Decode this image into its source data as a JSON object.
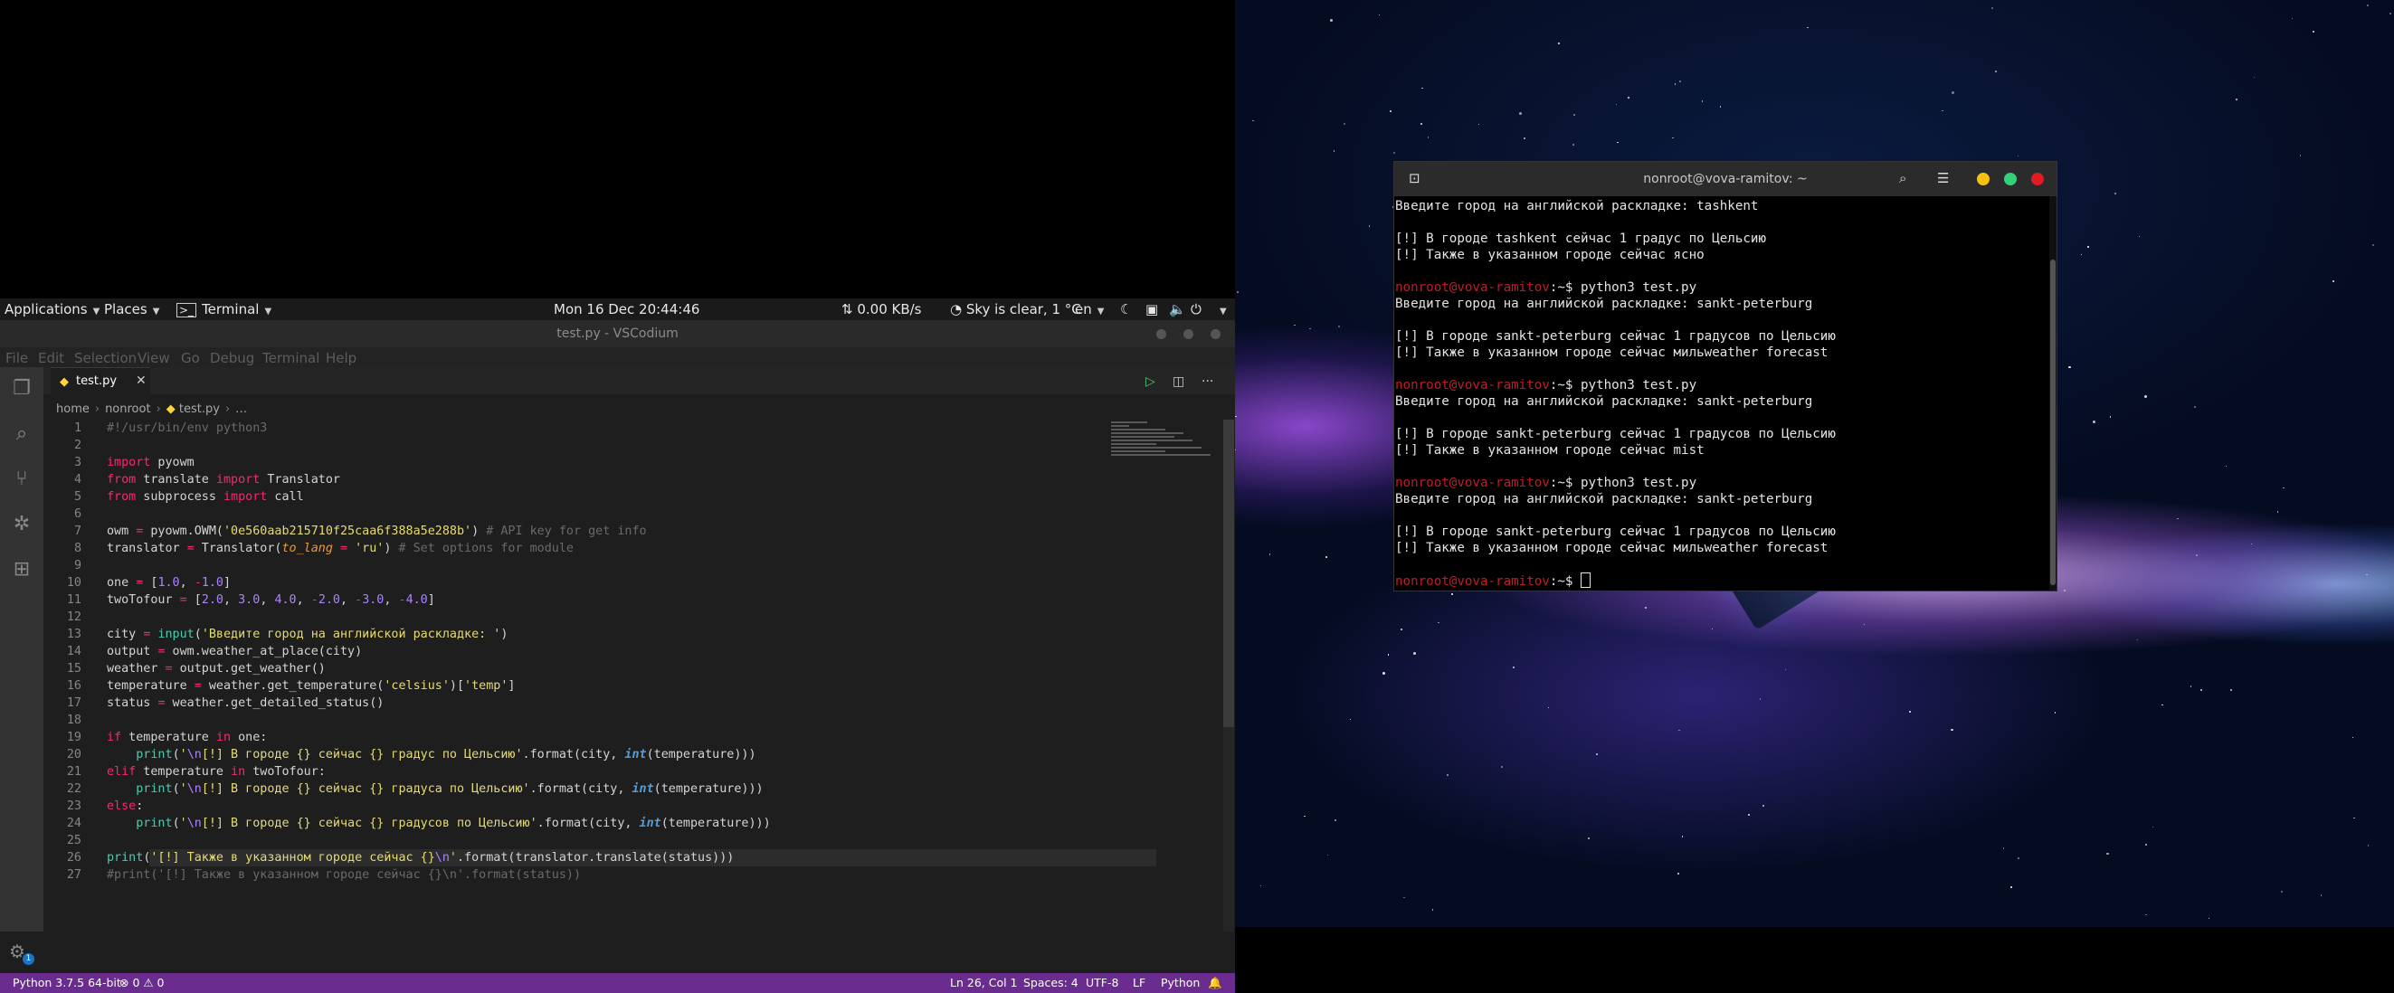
{
  "topbar": {
    "applications": "Applications",
    "places": "Places",
    "terminal": "Terminal",
    "clock": "Mon 16 Dec  20:44:46",
    "netspeed": "⇅ 0.00 KB/s",
    "weather": "Sky is clear, 1 °C",
    "lang": "en"
  },
  "vscode": {
    "title": "test.py - VSCodium",
    "menu": [
      "File",
      "Edit",
      "Selection",
      "View",
      "Go",
      "Debug",
      "Terminal",
      "Help"
    ],
    "tab_label": "test.py",
    "breadcrumb": [
      "home",
      "nonroot",
      "test.py",
      "…"
    ],
    "code_lines": [
      {
        "n": "1",
        "html": "<span class=\"dim\">#!/usr/bin/env python3</span>"
      },
      {
        "n": "2",
        "html": ""
      },
      {
        "n": "3",
        "html": "<span class=\"op\">import</span> pyowm"
      },
      {
        "n": "4",
        "html": "<span class=\"op\">from</span> translate <span class=\"op\">import</span> Translator"
      },
      {
        "n": "5",
        "html": "<span class=\"op\">from</span> subprocess <span class=\"op\">import</span> call"
      },
      {
        "n": "6",
        "html": ""
      },
      {
        "n": "7",
        "html": "owm <span class=\"op\">=</span> pyowm.OWM(<span class=\"ystr\">'0e560aab215710f25caa6f388a5e288b'</span>) <span class=\"dim\"># API key for get info</span>"
      },
      {
        "n": "8",
        "html": "translator <span class=\"op\">=</span> Translator(<span class=\"par\" style=\"color:#fd971f\">to_lang</span> <span class=\"op\">=</span> <span class=\"ystr\">'ru'</span>) <span class=\"dim\"># Set options for module</span>"
      },
      {
        "n": "9",
        "html": ""
      },
      {
        "n": "10",
        "html": "one <span class=\"op\">=</span> [<span class=\"pur\">1.0</span>, <span class=\"op\">-</span><span class=\"pur\">1.0</span>]"
      },
      {
        "n": "11",
        "html": "twoTofour <span class=\"op\">=</span> [<span class=\"pur\">2.0</span>, <span class=\"pur\">3.0</span>, <span class=\"pur\">4.0</span>, <span class=\"op\">-</span><span class=\"pur\">2.0</span>, <span class=\"op\">-</span><span class=\"pur\">3.0</span>, <span class=\"op\">-</span><span class=\"pur\">4.0</span>]"
      },
      {
        "n": "12",
        "html": ""
      },
      {
        "n": "13",
        "html": "city <span class=\"op\">=</span> <span class=\"cyan\">input</span>(<span class=\"ystr\">'Введите город на английской раскладке: '</span>)"
      },
      {
        "n": "14",
        "html": "output <span class=\"op\">=</span> owm.weather_at_place(city)"
      },
      {
        "n": "15",
        "html": "weather <span class=\"op\">=</span> output.get_weather()"
      },
      {
        "n": "16",
        "html": "temperature <span class=\"op\">=</span> weather.get_temperature(<span class=\"ystr\">'celsius'</span>)[<span class=\"ystr\">'temp'</span>]"
      },
      {
        "n": "17",
        "html": "status <span class=\"op\">=</span> weather.get_detailed_status()"
      },
      {
        "n": "18",
        "html": ""
      },
      {
        "n": "19",
        "html": "<span class=\"op\">if</span> temperature <span class=\"op\">in</span> one:"
      },
      {
        "n": "20",
        "html": "    <span class=\"cyan\">print</span>(<span class=\"ystr\">'</span><span class=\"pur\">\\n</span><span class=\"ystr\">[!] В городе {} сейчас {} градус по Цельсию'</span>.format(city, <span class=\"ib\">int</span>(temperature)))"
      },
      {
        "n": "21",
        "html": "<span class=\"op\">elif</span> temperature <span class=\"op\">in</span> twoTofour:"
      },
      {
        "n": "22",
        "html": "    <span class=\"cyan\">print</span>(<span class=\"ystr\">'</span><span class=\"pur\">\\n</span><span class=\"ystr\">[!] В городе {} сейчас {} градуса по Цельсию'</span>.format(city, <span class=\"ib\">int</span>(temperature)))"
      },
      {
        "n": "23",
        "html": "<span class=\"op\">else</span>:"
      },
      {
        "n": "24",
        "html": "    <span class=\"cyan\">print</span>(<span class=\"ystr\">'</span><span class=\"pur\">\\n</span><span class=\"ystr\">[!] В городе {} сейчас {} градусов по Цельсию'</span>.format(city, <span class=\"ib\">int</span>(temperature)))"
      },
      {
        "n": "25",
        "html": ""
      },
      {
        "n": "26",
        "html": "<span class=\"cyan\">print</span>(<span class=\"ystr\">'[!] Также в указанном городе сейчас {}</span><span class=\"pur\">\\n</span><span class=\"ystr\">'</span>.format(translator.translate(status)))"
      },
      {
        "n": "27",
        "html": "<span class=\"dim\">#print('[!] Также в указанном городе сейчас {}\\n'.format(status))</span>"
      }
    ],
    "status": {
      "python": "Python 3.7.5 64-bit",
      "problems": "⊗ 0 ⚠ 0",
      "position": "Ln 26, Col 1",
      "spaces": "Spaces: 4",
      "encoding": "UTF-8",
      "eol": "LF",
      "language": "Python"
    },
    "gear_badge": "1"
  },
  "terminal": {
    "title": "nonroot@vova-ramitov: ~",
    "lines": [
      {
        "t": "Введите город на английской раскладке: tashkent"
      },
      {
        "t": ""
      },
      {
        "t": "[!] В городе tashkent сейчас 1 градус по Цельсию"
      },
      {
        "t": "[!] Также в указанном городе сейчас ясно"
      },
      {
        "t": ""
      },
      {
        "p": "nonroot@vova-ramitov",
        "t": ":~$ python3 test.py"
      },
      {
        "t": "Введите город на английской раскладке: sankt-peterburg"
      },
      {
        "t": ""
      },
      {
        "t": "[!] В городе sankt-peterburg сейчас 1 градусов по Цельсию"
      },
      {
        "t": "[!] Также в указанном городе сейчас мильweather forecast"
      },
      {
        "t": ""
      },
      {
        "p": "nonroot@vova-ramitov",
        "t": ":~$ python3 test.py"
      },
      {
        "t": "Введите город на английской раскладке: sankt-peterburg"
      },
      {
        "t": ""
      },
      {
        "t": "[!] В городе sankt-peterburg сейчас 1 градусов по Цельсию"
      },
      {
        "t": "[!] Также в указанном городе сейчас mist"
      },
      {
        "t": ""
      },
      {
        "p": "nonroot@vova-ramitov",
        "t": ":~$ python3 test.py"
      },
      {
        "t": "Введите город на английской раскладке: sankt-peterburg"
      },
      {
        "t": ""
      },
      {
        "t": "[!] В городе sankt-peterburg сейчас 1 градусов по Цельсию"
      },
      {
        "t": "[!] Также в указанном городе сейчас мильweather forecast"
      },
      {
        "t": ""
      },
      {
        "p": "nonroot@vova-ramitov",
        "t": ":~$ ",
        "cursor": true
      }
    ]
  },
  "colors": {
    "statusbar": "#6a2c8f",
    "prompt": "#c01c28",
    "min": "#f5c211",
    "max": "#33d17a",
    "close": "#e01b24"
  }
}
